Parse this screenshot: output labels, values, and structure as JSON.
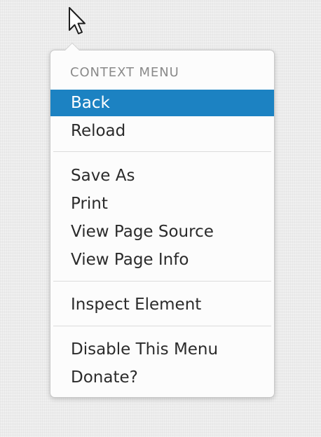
{
  "menu": {
    "title": "CONTEXT MENU",
    "groups": [
      [
        "Back",
        "Reload"
      ],
      [
        "Save As",
        "Print",
        "View Page Source",
        "View Page Info"
      ],
      [
        "Inspect Element"
      ],
      [
        "Disable This Menu",
        "Donate?"
      ]
    ],
    "highlighted_item": "Back"
  },
  "colors": {
    "highlight": "#1c82c2",
    "menu_background": "#fcfcfc",
    "title_text": "#8a8a8a",
    "item_text": "#2b2b2b"
  },
  "icons": [
    "mouse-pointer-icon"
  ]
}
